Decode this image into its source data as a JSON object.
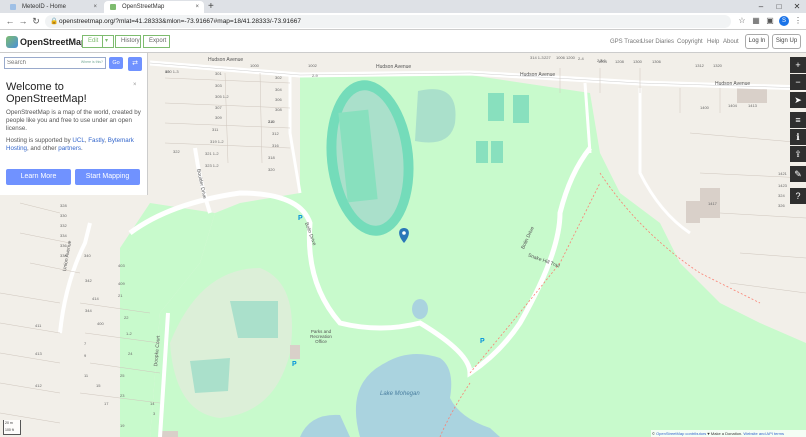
{
  "browser": {
    "tabs": [
      {
        "label": "MeteoID - Home",
        "active": false
      },
      {
        "label": "OpenStreetMap",
        "active": true
      }
    ],
    "close_glyph": "×",
    "new_tab_glyph": "+",
    "url": "openstreetmap.org/?mlat=41.28333&mlon=-73.91667#map=18/41.28333/-73.91667",
    "profile_initial": "S"
  },
  "header": {
    "brand": "OpenStreetMap",
    "edit_label": "Edit",
    "edit_dropdown_glyph": "▾",
    "history_label": "History",
    "export_label": "Export",
    "links": [
      "GPS Traces",
      "User Diaries",
      "Copyright",
      "Help",
      "About"
    ],
    "login_label": "Log In",
    "signup_label": "Sign Up"
  },
  "sidebar": {
    "search_placeholder": "Search",
    "where_hint": "Where is this?",
    "go_label": "Go",
    "welcome_title": "Welcome to OpenStreetMap!",
    "intro_text": "OpenStreetMap is a map of the world, created by people like you and free to use under an open license.",
    "hosting_prefix": "Hosting is supported by ",
    "hosting_link1": "UCL",
    "hosting_link2": "Fastly",
    "hosting_link3": "Bytemark Hosting",
    "hosting_mid": ", and other ",
    "hosting_link4": "partners",
    "learn_more_label": "Learn More",
    "start_mapping_label": "Start Mapping"
  },
  "map": {
    "street_labels": [
      {
        "text": "Hudson Avenue"
      },
      {
        "text": "Hudson Avenue"
      },
      {
        "text": "Hudson Avenue"
      },
      {
        "text": "Hudson Avenue"
      },
      {
        "text": "Bolin Drive"
      },
      {
        "text": "Bolin Drive"
      },
      {
        "text": "Boulder Drive"
      },
      {
        "text": "Union Avenue"
      },
      {
        "text": "Doopke Court"
      },
      {
        "text": "Snake Hill Trail"
      }
    ],
    "place_labels": [
      "Parks and Recreation Office",
      "Lake Mohegan"
    ],
    "parking_labels": [
      "P",
      "P",
      "P"
    ],
    "house_numbers": [
      "800 1-3",
      "301",
      "303",
      "305 1-2",
      "307",
      "309",
      "311",
      "319 1-2",
      "321 1-2",
      "323 1-2",
      "1000",
      "302",
      "304",
      "306",
      "308",
      "310",
      "312",
      "316",
      "318",
      "320",
      "322",
      "1002",
      "1006",
      "2-4",
      "2-5",
      "2-6",
      "2-8",
      "2-9",
      "314 1-3",
      "227",
      "1200",
      "1204",
      "1208",
      "1300",
      "1306",
      "1312",
      "1320",
      "1400",
      "1404",
      "1413",
      "1417",
      "1421",
      "1423",
      "324",
      "326",
      "328",
      "330",
      "332",
      "334",
      "336",
      "338",
      "340",
      "342",
      "344",
      "411",
      "413",
      "412",
      "414",
      "400",
      "403",
      "409",
      "21",
      "23",
      "25",
      "1-2",
      "7",
      "9",
      "11",
      "15",
      "17",
      "19",
      "22",
      "24",
      "14",
      "3",
      "13"
    ],
    "colors": {
      "land": "#f2efe9",
      "park": "#c8facc",
      "pitch": "#aae0cb",
      "track": "#74dcba",
      "water": "#aad3df",
      "building": "#d9d0c9",
      "road": "#ffffff",
      "marker": "#2a76b8"
    }
  },
  "controls": {
    "zoom_in": "+",
    "zoom_out": "−",
    "locate": "➤",
    "layers": "≡",
    "legend": "ℹ",
    "share": "⇪",
    "note": "✎",
    "query": "?"
  },
  "scale": {
    "metric": "20 m",
    "imperial": "100 ft"
  },
  "attribution": {
    "prefix": "© ",
    "osm_link": "OpenStreetMap contributors",
    "middle": " ♥ Make a Donation. ",
    "terms_link": "Website and API terms"
  }
}
